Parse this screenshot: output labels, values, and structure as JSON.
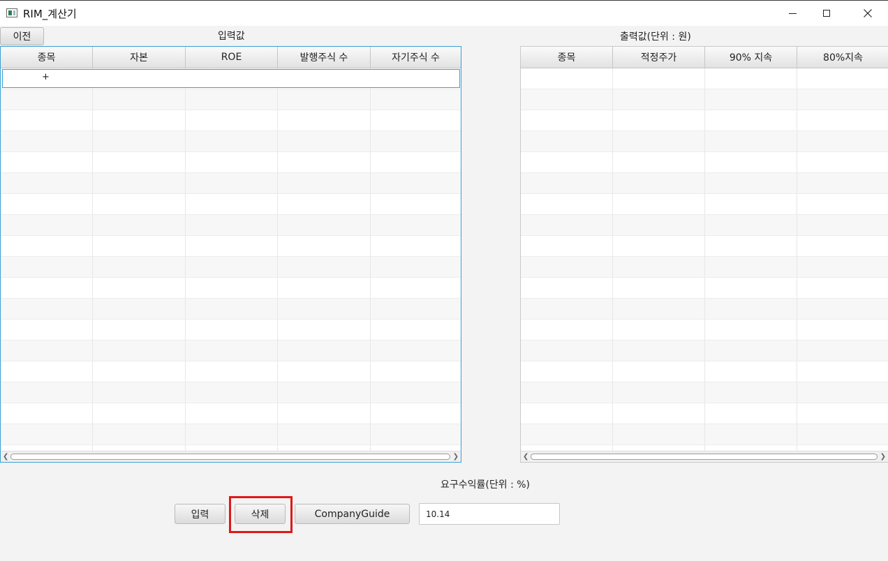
{
  "window": {
    "title": "RIM_계산기",
    "icons": [
      "app-icon",
      "minimize-icon",
      "maximize-icon",
      "close-icon"
    ]
  },
  "toolbar": {
    "prev_label": "이전"
  },
  "input_panel": {
    "title": "입력값",
    "columns": [
      "종목",
      "자본",
      "ROE",
      "발행주식 수",
      "자기주식 수"
    ],
    "new_row_marker": "+"
  },
  "output_panel": {
    "title": "출력값(단위 : 원)",
    "columns": [
      "종목",
      "적정주가",
      "90% 지속",
      "80%지속"
    ]
  },
  "bottom": {
    "rate_label": "요구수익률(단위 : %)",
    "input_button": "입력",
    "delete_button": "삭제",
    "companyguide_button": "CompanyGuide",
    "rate_value": "10.14"
  },
  "colors": {
    "accent": "#39a0d6",
    "highlight": "#e01818"
  }
}
